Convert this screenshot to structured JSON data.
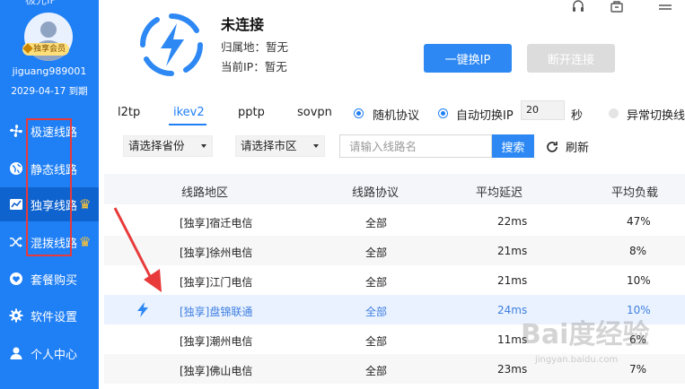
{
  "app": {
    "name": "极光IP"
  },
  "user": {
    "vip_badge": "独享会员",
    "username": "jiguang989001",
    "expire": "2029-04-17 到期"
  },
  "sidebar": {
    "items": [
      {
        "label": "极速线路",
        "icon": "fan-icon",
        "active": false,
        "crown": false
      },
      {
        "label": "静态线路",
        "icon": "globe-icon",
        "active": false,
        "crown": false
      },
      {
        "label": "独享线路",
        "icon": "chart-icon",
        "active": true,
        "crown": true
      },
      {
        "label": "混拨线路",
        "icon": "shuffle-icon",
        "active": false,
        "crown": true
      },
      {
        "label": "套餐购买",
        "icon": "heart-icon",
        "active": false,
        "crown": false
      },
      {
        "label": "软件设置",
        "icon": "gear-icon",
        "active": false,
        "crown": false
      },
      {
        "label": "个人中心",
        "icon": "user-icon",
        "active": false,
        "crown": false
      }
    ]
  },
  "header": {
    "status": "未连接",
    "location_label": "归属地：",
    "location_value": "暂无",
    "ip_label": "当前IP：",
    "ip_value": "暂无",
    "connect_button": "一键换IP",
    "disconnect_button": "断开连接"
  },
  "protocols": {
    "tabs": [
      "l2tp",
      "ikev2",
      "pptp",
      "sovpn"
    ],
    "active_tab": "ikev2",
    "random_protocol": "随机协议",
    "auto_switch": "自动切换IP",
    "auto_switch_seconds": "20",
    "seconds_unit": "秒",
    "abnormal_switch": "异常切换线"
  },
  "filters": {
    "province": "请选择省份",
    "city": "请选择市区",
    "search_placeholder": "请输入线路名",
    "search_button": "搜索",
    "refresh": "刷新"
  },
  "table": {
    "headers": [
      "线路地区",
      "线路协议",
      "平均延迟",
      "平均负载"
    ],
    "rows": [
      {
        "region": "[独享]宿迁电信",
        "protocol": "全部",
        "latency": "22ms",
        "load": "47%",
        "current": false
      },
      {
        "region": "[独享]徐州电信",
        "protocol": "全部",
        "latency": "21ms",
        "load": "8%",
        "current": false
      },
      {
        "region": "[独享]江门电信",
        "protocol": "全部",
        "latency": "21ms",
        "load": "10%",
        "current": false
      },
      {
        "region": "[独享]盘锦联通",
        "protocol": "全部",
        "latency": "24ms",
        "load": "10%",
        "current": true
      },
      {
        "region": "[独享]潮州电信",
        "protocol": "全部",
        "latency": "11ms",
        "load": "6%",
        "current": false
      },
      {
        "region": "[独享]佛山电信",
        "protocol": "全部",
        "latency": "23ms",
        "load": "7%",
        "current": false
      }
    ]
  },
  "watermark": {
    "text": "Bai度经验",
    "sub": "jingyan.baidu.com"
  },
  "colors": {
    "primary": "#1f7ff5",
    "active_nav": "#0f63cf",
    "annotation": "#e83a3a",
    "crown": "#ffc533"
  }
}
